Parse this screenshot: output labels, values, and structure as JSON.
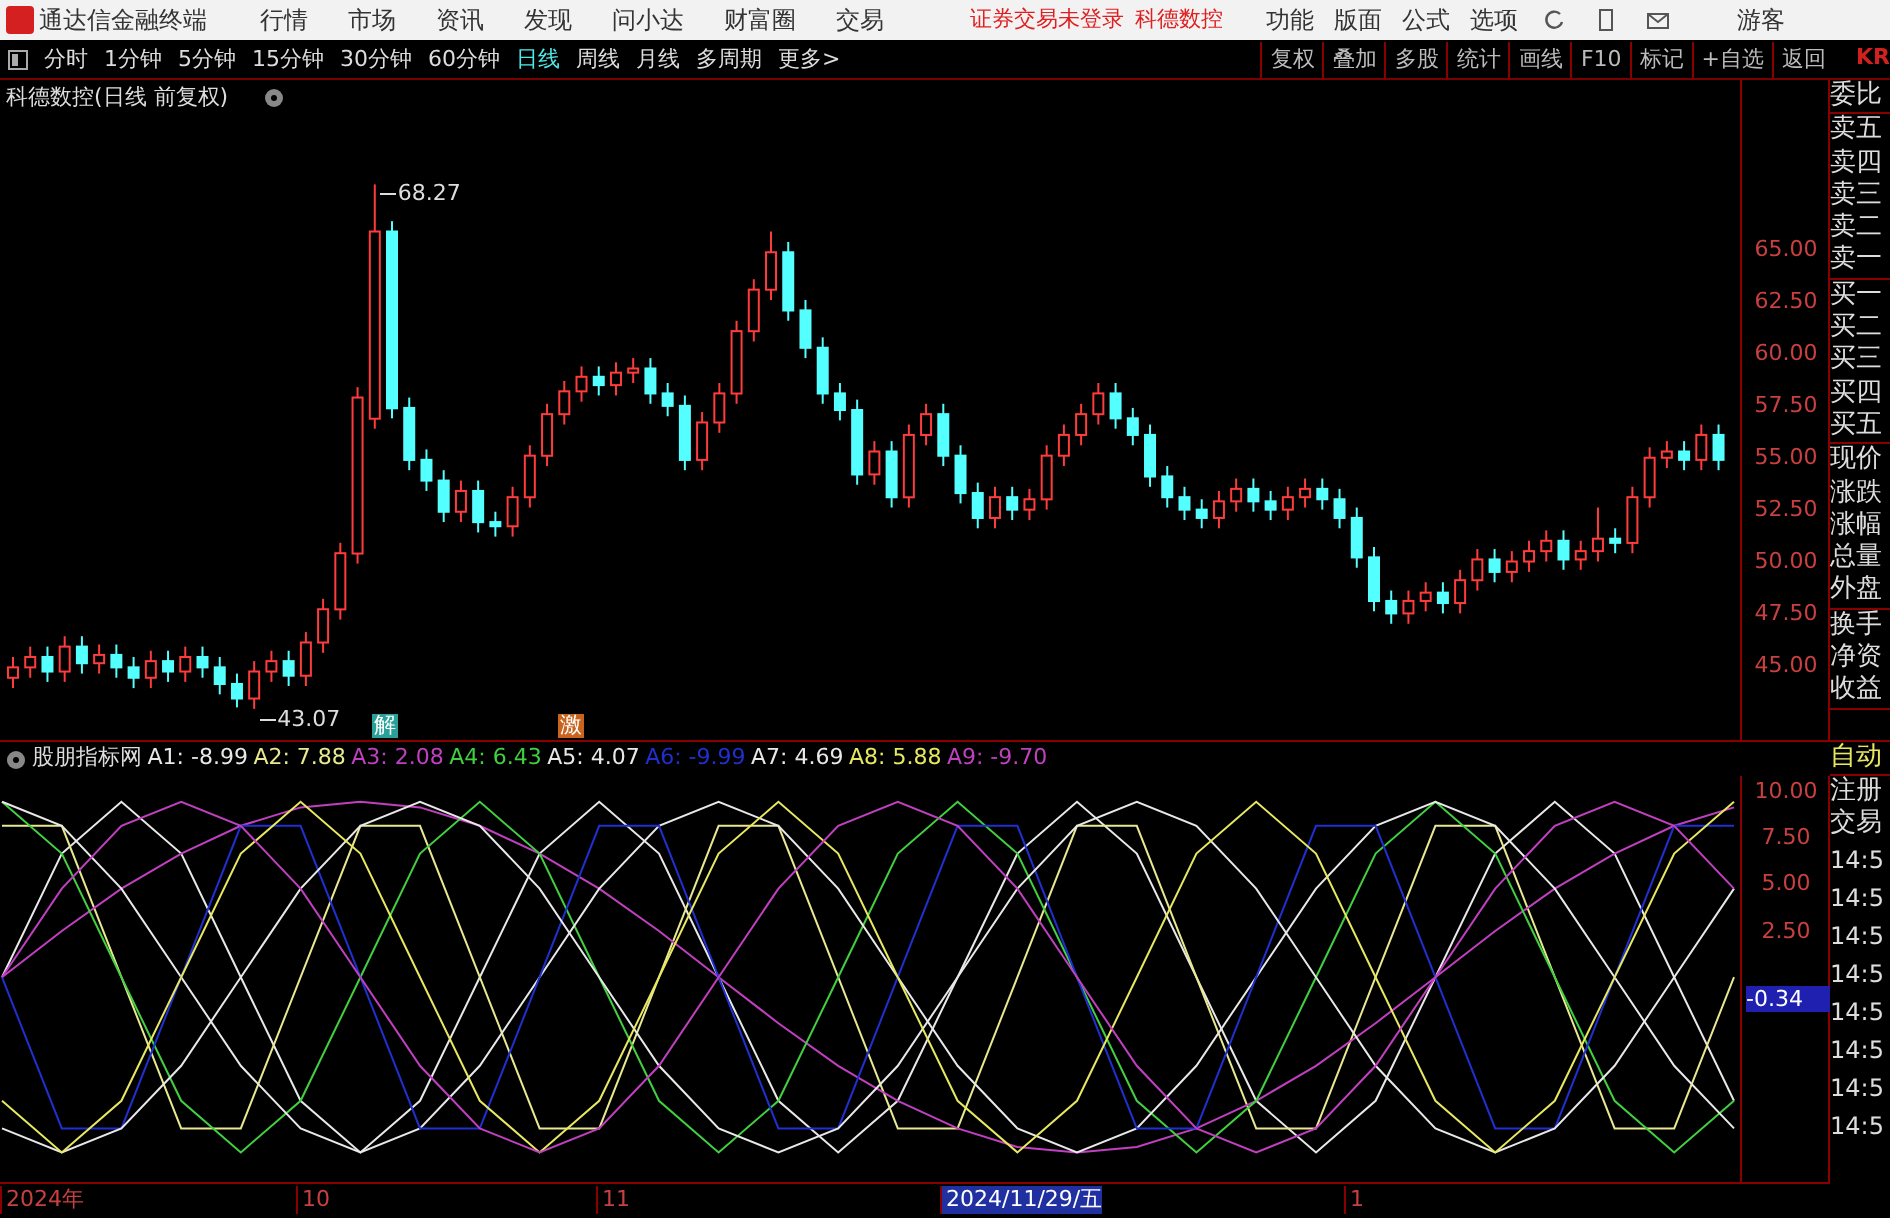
{
  "title_bar": {
    "app_name": "通达信金融终端",
    "menus": [
      "行情",
      "市场",
      "资讯",
      "发现",
      "问小达",
      "财富圈",
      "交易"
    ],
    "status_text": "证券交易未登录",
    "stock_name": "科德数控",
    "right_menus": [
      "功能",
      "版面",
      "公式",
      "选项"
    ],
    "user": "游客"
  },
  "toolbar": {
    "periods": [
      {
        "label": "分时",
        "selected": false
      },
      {
        "label": "1分钟",
        "selected": false
      },
      {
        "label": "5分钟",
        "selected": false
      },
      {
        "label": "15分钟",
        "selected": false
      },
      {
        "label": "30分钟",
        "selected": false
      },
      {
        "label": "60分钟",
        "selected": false
      },
      {
        "label": "日线",
        "selected": true
      },
      {
        "label": "周线",
        "selected": false
      },
      {
        "label": "月线",
        "selected": false
      },
      {
        "label": "多周期",
        "selected": false
      },
      {
        "label": "更多>",
        "selected": false
      }
    ],
    "buttons": [
      "复权",
      "叠加",
      "多股",
      "统计",
      "画线",
      "F10",
      "标记",
      "+自选",
      "返回"
    ],
    "edge_label": "KR"
  },
  "main_chart": {
    "title": "科德数控(日线 前复权)",
    "high_label": "68.27",
    "low_label": "43.07",
    "markers": [
      {
        "label": "解",
        "color": "#2aa198"
      },
      {
        "label": "激",
        "color": "#c8641e"
      }
    ],
    "chart_data": {
      "type": "candlestick",
      "ylim": [
        41.5,
        73.3
      ],
      "yticks": [
        {
          "value": 65,
          "label": "65.00"
        },
        {
          "value": 62.5,
          "label": "62.50"
        },
        {
          "value": 60,
          "label": "60.00"
        },
        {
          "value": 57.5,
          "label": "57.50"
        },
        {
          "value": 55,
          "label": "55.00"
        },
        {
          "value": 52.5,
          "label": "52.50"
        },
        {
          "value": 50,
          "label": "50.00"
        },
        {
          "value": 47.5,
          "label": "47.50"
        },
        {
          "value": 45,
          "label": "45.00"
        }
      ],
      "ohlc": [
        [
          44.5,
          45.5,
          44,
          45
        ],
        [
          45,
          46,
          44.5,
          45.5
        ],
        [
          45.5,
          46,
          44.3,
          44.8
        ],
        [
          44.8,
          46.5,
          44.3,
          46
        ],
        [
          46,
          46.5,
          44.7,
          45.2
        ],
        [
          45.2,
          46.1,
          44.7,
          45.6
        ],
        [
          45.6,
          46.1,
          44.5,
          45
        ],
        [
          45,
          45.5,
          44,
          44.5
        ],
        [
          44.5,
          45.8,
          44,
          45.3
        ],
        [
          45.3,
          45.8,
          44.3,
          44.8
        ],
        [
          44.8,
          46,
          44.3,
          45.5
        ],
        [
          45.5,
          46,
          44.5,
          45
        ],
        [
          45,
          45.5,
          43.7,
          44.2
        ],
        [
          44.2,
          44.7,
          43.07,
          43.5
        ],
        [
          43.5,
          45.3,
          43,
          44.8
        ],
        [
          44.8,
          45.8,
          44.3,
          45.3
        ],
        [
          45.3,
          45.8,
          44.1,
          44.6
        ],
        [
          44.6,
          46.7,
          44.1,
          46.2
        ],
        [
          46.2,
          48.3,
          45.7,
          47.8
        ],
        [
          47.8,
          51,
          47.3,
          50.5
        ],
        [
          50.5,
          58.5,
          50,
          58
        ],
        [
          57,
          68.27,
          56.5,
          66
        ],
        [
          66,
          66.5,
          57,
          57.5
        ],
        [
          57.5,
          58,
          54.5,
          55
        ],
        [
          55,
          55.5,
          53.5,
          54
        ],
        [
          54,
          54.5,
          52,
          52.5
        ],
        [
          52.5,
          54,
          52,
          53.5
        ],
        [
          53.5,
          54,
          51.5,
          52
        ],
        [
          52,
          52.5,
          51.3,
          51.8
        ],
        [
          51.8,
          53.7,
          51.3,
          53.2
        ],
        [
          53.2,
          55.7,
          52.7,
          55.2
        ],
        [
          55.2,
          57.7,
          54.7,
          57.2
        ],
        [
          57.2,
          58.8,
          56.7,
          58.3
        ],
        [
          58.3,
          59.5,
          57.8,
          59
        ],
        [
          59,
          59.5,
          58.1,
          58.6
        ],
        [
          58.6,
          59.7,
          58.1,
          59.2
        ],
        [
          59.2,
          59.9,
          58.7,
          59.4
        ],
        [
          59.4,
          59.9,
          57.7,
          58.2
        ],
        [
          58.2,
          58.7,
          57.1,
          57.6
        ],
        [
          57.6,
          58.1,
          54.5,
          55
        ],
        [
          55,
          57.3,
          54.5,
          56.8
        ],
        [
          56.8,
          58.7,
          56.3,
          58.2
        ],
        [
          58.2,
          61.7,
          57.7,
          61.2
        ],
        [
          61.2,
          63.7,
          60.7,
          63.2
        ],
        [
          63.2,
          66,
          62.7,
          65
        ],
        [
          65,
          65.5,
          61.7,
          62.2
        ],
        [
          62.2,
          62.7,
          59.9,
          60.4
        ],
        [
          60.4,
          60.9,
          57.7,
          58.2
        ],
        [
          58.2,
          58.7,
          56.9,
          57.4
        ],
        [
          57.4,
          57.9,
          53.8,
          54.3
        ],
        [
          54.3,
          55.9,
          53.8,
          55.4
        ],
        [
          55.4,
          55.9,
          52.7,
          53.2
        ],
        [
          53.2,
          56.7,
          52.7,
          56.2
        ],
        [
          56.2,
          57.7,
          55.7,
          57.2
        ],
        [
          57.2,
          57.7,
          54.7,
          55.2
        ],
        [
          55.2,
          55.7,
          52.9,
          53.4
        ],
        [
          53.4,
          53.9,
          51.7,
          52.2
        ],
        [
          52.2,
          53.7,
          51.7,
          53.2
        ],
        [
          53.2,
          53.7,
          52.1,
          52.6
        ],
        [
          52.6,
          53.6,
          52.1,
          53.1
        ],
        [
          53.1,
          55.7,
          52.6,
          55.2
        ],
        [
          55.2,
          56.7,
          54.7,
          56.2
        ],
        [
          56.2,
          57.7,
          55.7,
          57.2
        ],
        [
          57.2,
          58.7,
          56.7,
          58.2
        ],
        [
          58.2,
          58.7,
          56.5,
          57
        ],
        [
          57,
          57.5,
          55.7,
          56.2
        ],
        [
          56.2,
          56.7,
          53.7,
          54.2
        ],
        [
          54.2,
          54.7,
          52.7,
          53.2
        ],
        [
          53.2,
          53.7,
          52.1,
          52.6
        ],
        [
          52.6,
          53.1,
          51.7,
          52.2
        ],
        [
          52.2,
          53.5,
          51.7,
          53
        ],
        [
          53,
          54.1,
          52.5,
          53.6
        ],
        [
          53.6,
          54.1,
          52.5,
          53
        ],
        [
          53,
          53.5,
          52.1,
          52.6
        ],
        [
          52.6,
          53.7,
          52.1,
          53.2
        ],
        [
          53.2,
          54.1,
          52.7,
          53.6
        ],
        [
          53.6,
          54.1,
          52.6,
          53.1
        ],
        [
          53.1,
          53.6,
          51.7,
          52.2
        ],
        [
          52.2,
          52.7,
          49.8,
          50.3
        ],
        [
          50.3,
          50.8,
          47.7,
          48.2
        ],
        [
          48.2,
          48.7,
          47.1,
          47.6
        ],
        [
          47.6,
          48.7,
          47.1,
          48.2
        ],
        [
          48.2,
          49.1,
          47.7,
          48.6
        ],
        [
          48.6,
          49.1,
          47.6,
          48.1
        ],
        [
          48.1,
          49.7,
          47.6,
          49.2
        ],
        [
          49.2,
          50.7,
          48.7,
          50.2
        ],
        [
          50.2,
          50.7,
          49.1,
          49.6
        ],
        [
          49.6,
          50.6,
          49.1,
          50.1
        ],
        [
          50.1,
          51.1,
          49.6,
          50.6
        ],
        [
          50.6,
          51.6,
          50.1,
          51.1
        ],
        [
          51.1,
          51.6,
          49.7,
          50.2
        ],
        [
          50.2,
          51.1,
          49.7,
          50.6
        ],
        [
          50.6,
          52.7,
          50.1,
          51.2
        ],
        [
          51.2,
          51.7,
          50.5,
          51
        ],
        [
          51,
          53.7,
          50.5,
          53.2
        ],
        [
          53.2,
          55.6,
          52.7,
          55.1
        ],
        [
          55.1,
          55.9,
          54.6,
          55.4
        ],
        [
          55.4,
          55.9,
          54.5,
          55
        ],
        [
          55,
          56.7,
          54.5,
          56.2
        ],
        [
          56.2,
          56.7,
          54.5,
          55
        ]
      ]
    }
  },
  "indicator": {
    "name": "股朋指标网",
    "values": [
      "-8.99",
      "7.88",
      "2.08",
      "6.43",
      "4.07",
      "-9.99",
      "4.69",
      "5.88",
      "-9.70"
    ],
    "current_value": "-0.34",
    "chart_data": {
      "type": "line",
      "ylim": [
        -11.1,
        10.9
      ],
      "yticks": [
        {
          "value": 10,
          "label": "10.00"
        },
        {
          "value": 7.5,
          "label": "7.50"
        },
        {
          "value": 5,
          "label": "5.00"
        },
        {
          "value": 2.5,
          "label": "2.50"
        }
      ],
      "series": [
        {
          "name": "A1:",
          "color": "#e8e8e8",
          "values": [
            0,
            6.7,
            9.5,
            6.7,
            0,
            -6.7,
            -9.5,
            -6.7,
            0,
            6.7,
            9.5,
            6.7,
            0,
            -6.7,
            -9.5,
            -6.7,
            0,
            6.7,
            9.5,
            6.7,
            0,
            -6.7,
            -9.5,
            -6.7,
            0,
            6.7,
            9.5,
            6.7,
            0,
            -6.7
          ]
        },
        {
          "name": "A2:",
          "color": "#e8e890",
          "values": [
            8.2,
            8.2,
            0,
            -8.2,
            -8.2,
            0,
            8.2,
            8.2,
            0,
            -8.2,
            -8.2,
            0,
            8.2,
            8.2,
            0,
            -8.2,
            -8.2,
            0,
            8.2,
            8.2,
            0,
            -8.2,
            -8.2,
            0,
            8.2,
            8.2,
            0,
            -8.2,
            -8.2,
            0
          ]
        },
        {
          "name": "A3:",
          "color": "#c040c0",
          "values": [
            0,
            2.5,
            4.8,
            6.7,
            8.2,
            9.2,
            9.5,
            9.2,
            8.2,
            6.7,
            4.8,
            2.5,
            0,
            -2.5,
            -4.8,
            -6.7,
            -8.2,
            -9.2,
            -9.5,
            -9.2,
            -8.2,
            -6.7,
            -4.8,
            -2.5,
            0,
            2.5,
            4.8,
            6.7,
            8.2,
            9.2
          ]
        },
        {
          "name": "A4:",
          "color": "#40d040",
          "values": [
            9.5,
            6.7,
            0,
            -6.7,
            -9.5,
            -6.7,
            0,
            6.7,
            9.5,
            6.7,
            0,
            -6.7,
            -9.5,
            -6.7,
            0,
            6.7,
            9.5,
            6.7,
            0,
            -6.7,
            -9.5,
            -6.7,
            0,
            6.7,
            9.5,
            6.7,
            0,
            -6.7,
            -9.5,
            -6.7
          ]
        },
        {
          "name": "A5:",
          "color": "#e8e8e8",
          "values": [
            9.5,
            8.2,
            4.8,
            0,
            -4.8,
            -8.2,
            -9.5,
            -8.2,
            -4.8,
            0,
            4.8,
            8.2,
            9.5,
            8.2,
            4.8,
            0,
            -4.8,
            -8.2,
            -9.5,
            -8.2,
            -4.8,
            0,
            4.8,
            8.2,
            9.5,
            8.2,
            4.8,
            0,
            -4.8,
            -8.2
          ]
        },
        {
          "name": "A6:",
          "color": "#2030d0",
          "values": [
            0,
            -8.2,
            -8.2,
            0,
            8.2,
            8.2,
            0,
            -8.2,
            -8.2,
            0,
            8.2,
            8.2,
            0,
            -8.2,
            -8.2,
            0,
            8.2,
            8.2,
            0,
            -8.2,
            -8.2,
            0,
            8.2,
            8.2,
            0,
            -8.2,
            -8.2,
            0,
            8.2,
            8.2
          ]
        },
        {
          "name": "A7:",
          "color": "#e8e8e8",
          "values": [
            -8.2,
            -9.5,
            -8.2,
            -4.8,
            0,
            4.8,
            8.2,
            9.5,
            8.2,
            4.8,
            0,
            -4.8,
            -8.2,
            -9.5,
            -8.2,
            -4.8,
            0,
            4.8,
            8.2,
            9.5,
            8.2,
            4.8,
            0,
            -4.8,
            -8.2,
            -9.5,
            -8.2,
            -4.8,
            0,
            4.8
          ]
        },
        {
          "name": "A8:",
          "color": "#e8e860",
          "values": [
            -6.7,
            -9.5,
            -6.7,
            0,
            6.7,
            9.5,
            6.7,
            0,
            -6.7,
            -9.5,
            -6.7,
            0,
            6.7,
            9.5,
            6.7,
            0,
            -6.7,
            -9.5,
            -6.7,
            0,
            6.7,
            9.5,
            6.7,
            0,
            -6.7,
            -9.5,
            -6.7,
            0,
            6.7,
            9.5
          ]
        },
        {
          "name": "A9:",
          "color": "#c040c0",
          "values": [
            0,
            4.8,
            8.2,
            9.5,
            8.2,
            4.8,
            0,
            -4.8,
            -8.2,
            -9.5,
            -8.2,
            -4.8,
            0,
            4.8,
            8.2,
            9.5,
            8.2,
            4.8,
            0,
            -4.8,
            -8.2,
            -9.5,
            -8.2,
            -4.8,
            0,
            4.8,
            8.2,
            9.5,
            8.2,
            4.8
          ]
        }
      ]
    }
  },
  "side_panel": {
    "quote_groups": [
      [
        "委比"
      ],
      [
        "卖五",
        "卖四",
        "卖三",
        "卖二",
        "卖一"
      ],
      [
        "买一",
        "买二",
        "买三",
        "买四",
        "买五"
      ],
      [
        "现价",
        "涨跌",
        "涨幅",
        "总量",
        "外盘"
      ],
      [
        "换手",
        "净资",
        "收益"
      ]
    ],
    "mode": "自动",
    "links": [
      "注册",
      "交易"
    ],
    "times": [
      "14:5",
      "14:5",
      "14:5",
      "14:5",
      "14:5",
      "14:5",
      "14:5",
      "14:5"
    ]
  },
  "x_axis": [
    {
      "label": "2024年",
      "selected": false
    },
    {
      "label": "10",
      "selected": false
    },
    {
      "label": "11",
      "selected": false
    },
    {
      "label": "2024/11/29/五",
      "selected": true
    },
    {
      "label": "1",
      "selected": false
    }
  ]
}
